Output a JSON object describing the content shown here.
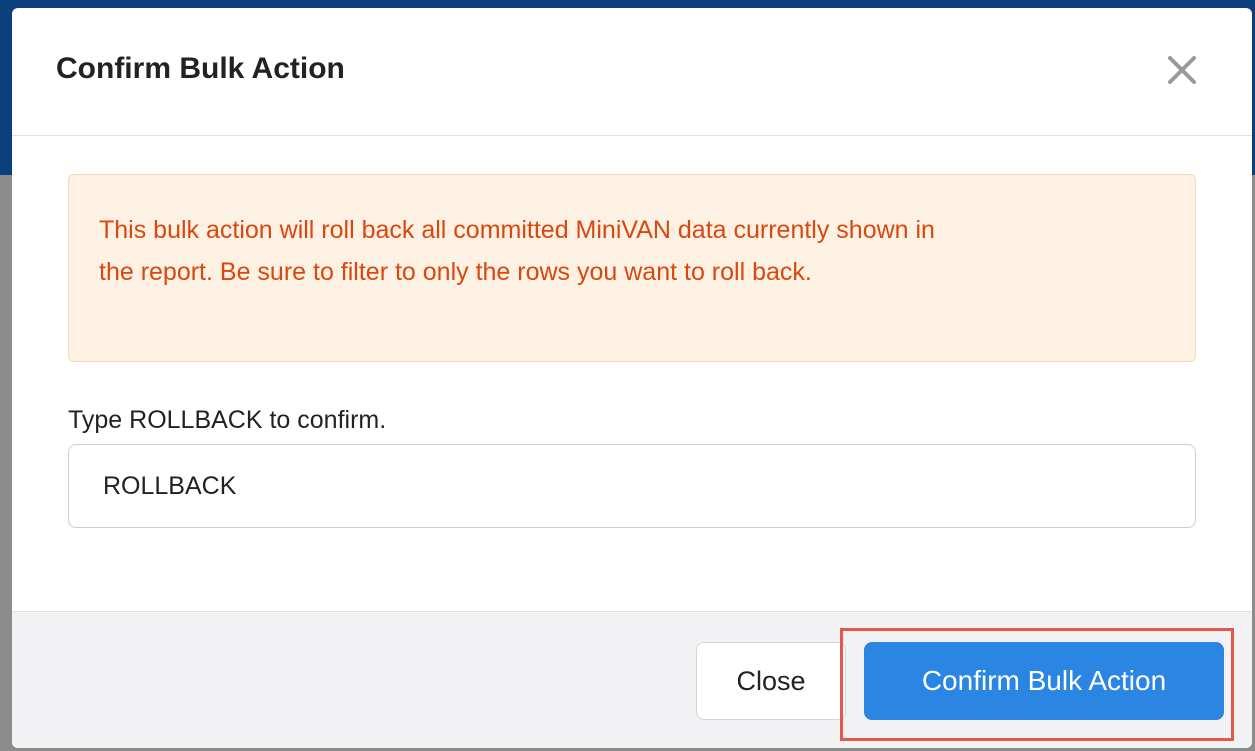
{
  "modal": {
    "title": "Confirm Bulk Action",
    "close_icon": "close-icon",
    "alert": {
      "text": "This bulk action will roll back all committed MiniVAN data currently shown in the report. Be sure to filter to only the rows you want to roll back.",
      "color": "#d9480f",
      "background": "#fdf1e4"
    },
    "confirm_label": "Type ROLLBACK to confirm.",
    "confirm_input_value": "ROLLBACK",
    "footer": {
      "close_label": "Close",
      "confirm_label": "Confirm Bulk Action",
      "confirm_color": "#2b86e3",
      "highlight_color": "#e4574b"
    }
  }
}
